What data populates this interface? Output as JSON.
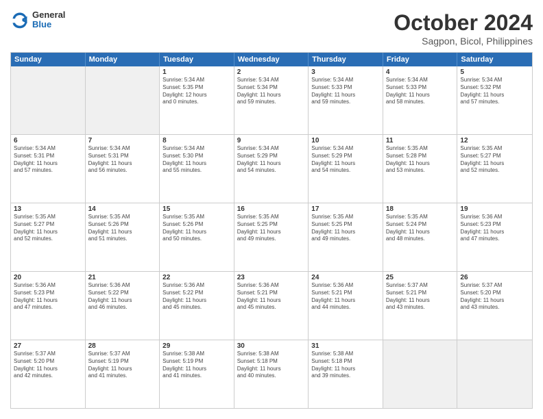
{
  "header": {
    "logo": {
      "general": "General",
      "blue": "Blue"
    },
    "title": "October 2024",
    "location": "Sagpon, Bicol, Philippines"
  },
  "weekdays": [
    "Sunday",
    "Monday",
    "Tuesday",
    "Wednesday",
    "Thursday",
    "Friday",
    "Saturday"
  ],
  "rows": [
    [
      {
        "day": "",
        "info": ""
      },
      {
        "day": "",
        "info": ""
      },
      {
        "day": "1",
        "info": "Sunrise: 5:34 AM\nSunset: 5:35 PM\nDaylight: 12 hours\nand 0 minutes."
      },
      {
        "day": "2",
        "info": "Sunrise: 5:34 AM\nSunset: 5:34 PM\nDaylight: 11 hours\nand 59 minutes."
      },
      {
        "day": "3",
        "info": "Sunrise: 5:34 AM\nSunset: 5:33 PM\nDaylight: 11 hours\nand 59 minutes."
      },
      {
        "day": "4",
        "info": "Sunrise: 5:34 AM\nSunset: 5:33 PM\nDaylight: 11 hours\nand 58 minutes."
      },
      {
        "day": "5",
        "info": "Sunrise: 5:34 AM\nSunset: 5:32 PM\nDaylight: 11 hours\nand 57 minutes."
      }
    ],
    [
      {
        "day": "6",
        "info": "Sunrise: 5:34 AM\nSunset: 5:31 PM\nDaylight: 11 hours\nand 57 minutes."
      },
      {
        "day": "7",
        "info": "Sunrise: 5:34 AM\nSunset: 5:31 PM\nDaylight: 11 hours\nand 56 minutes."
      },
      {
        "day": "8",
        "info": "Sunrise: 5:34 AM\nSunset: 5:30 PM\nDaylight: 11 hours\nand 55 minutes."
      },
      {
        "day": "9",
        "info": "Sunrise: 5:34 AM\nSunset: 5:29 PM\nDaylight: 11 hours\nand 54 minutes."
      },
      {
        "day": "10",
        "info": "Sunrise: 5:34 AM\nSunset: 5:29 PM\nDaylight: 11 hours\nand 54 minutes."
      },
      {
        "day": "11",
        "info": "Sunrise: 5:35 AM\nSunset: 5:28 PM\nDaylight: 11 hours\nand 53 minutes."
      },
      {
        "day": "12",
        "info": "Sunrise: 5:35 AM\nSunset: 5:27 PM\nDaylight: 11 hours\nand 52 minutes."
      }
    ],
    [
      {
        "day": "13",
        "info": "Sunrise: 5:35 AM\nSunset: 5:27 PM\nDaylight: 11 hours\nand 52 minutes."
      },
      {
        "day": "14",
        "info": "Sunrise: 5:35 AM\nSunset: 5:26 PM\nDaylight: 11 hours\nand 51 minutes."
      },
      {
        "day": "15",
        "info": "Sunrise: 5:35 AM\nSunset: 5:26 PM\nDaylight: 11 hours\nand 50 minutes."
      },
      {
        "day": "16",
        "info": "Sunrise: 5:35 AM\nSunset: 5:25 PM\nDaylight: 11 hours\nand 49 minutes."
      },
      {
        "day": "17",
        "info": "Sunrise: 5:35 AM\nSunset: 5:25 PM\nDaylight: 11 hours\nand 49 minutes."
      },
      {
        "day": "18",
        "info": "Sunrise: 5:35 AM\nSunset: 5:24 PM\nDaylight: 11 hours\nand 48 minutes."
      },
      {
        "day": "19",
        "info": "Sunrise: 5:36 AM\nSunset: 5:23 PM\nDaylight: 11 hours\nand 47 minutes."
      }
    ],
    [
      {
        "day": "20",
        "info": "Sunrise: 5:36 AM\nSunset: 5:23 PM\nDaylight: 11 hours\nand 47 minutes."
      },
      {
        "day": "21",
        "info": "Sunrise: 5:36 AM\nSunset: 5:22 PM\nDaylight: 11 hours\nand 46 minutes."
      },
      {
        "day": "22",
        "info": "Sunrise: 5:36 AM\nSunset: 5:22 PM\nDaylight: 11 hours\nand 45 minutes."
      },
      {
        "day": "23",
        "info": "Sunrise: 5:36 AM\nSunset: 5:21 PM\nDaylight: 11 hours\nand 45 minutes."
      },
      {
        "day": "24",
        "info": "Sunrise: 5:36 AM\nSunset: 5:21 PM\nDaylight: 11 hours\nand 44 minutes."
      },
      {
        "day": "25",
        "info": "Sunrise: 5:37 AM\nSunset: 5:21 PM\nDaylight: 11 hours\nand 43 minutes."
      },
      {
        "day": "26",
        "info": "Sunrise: 5:37 AM\nSunset: 5:20 PM\nDaylight: 11 hours\nand 43 minutes."
      }
    ],
    [
      {
        "day": "27",
        "info": "Sunrise: 5:37 AM\nSunset: 5:20 PM\nDaylight: 11 hours\nand 42 minutes."
      },
      {
        "day": "28",
        "info": "Sunrise: 5:37 AM\nSunset: 5:19 PM\nDaylight: 11 hours\nand 41 minutes."
      },
      {
        "day": "29",
        "info": "Sunrise: 5:38 AM\nSunset: 5:19 PM\nDaylight: 11 hours\nand 41 minutes."
      },
      {
        "day": "30",
        "info": "Sunrise: 5:38 AM\nSunset: 5:18 PM\nDaylight: 11 hours\nand 40 minutes."
      },
      {
        "day": "31",
        "info": "Sunrise: 5:38 AM\nSunset: 5:18 PM\nDaylight: 11 hours\nand 39 minutes."
      },
      {
        "day": "",
        "info": ""
      },
      {
        "day": "",
        "info": ""
      }
    ]
  ]
}
